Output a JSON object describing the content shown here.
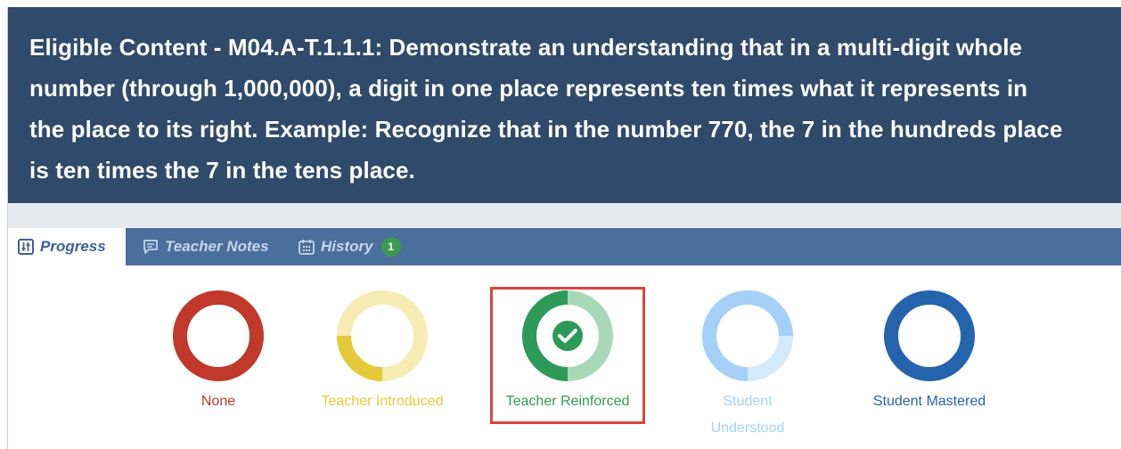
{
  "header": {
    "lines": [
      "Eligible Content - M04.A-T.1.1.1: Demonstrate an understanding that in a multi-digit whole",
      "number (through 1,000,000), a digit in one place represents ten times what it represents in",
      "the place to its right. Example: Recognize that in the number 770, the 7 in the hundreds place",
      "is ten times the 7 in the tens place."
    ]
  },
  "tabs": [
    {
      "label": "Progress",
      "icon": "sliders-icon",
      "active": true
    },
    {
      "label": "Teacher Notes",
      "icon": "comment-icon",
      "active": false
    },
    {
      "label": "History",
      "icon": "calendar-icon",
      "active": false,
      "badge": "1"
    }
  ],
  "statuses": [
    {
      "label": "None",
      "color": "#c0392b",
      "level": 0
    },
    {
      "label": "Teacher Introduced",
      "color": "#e6c93b",
      "light_color": "#f6ebb3",
      "level": 0.33
    },
    {
      "label": "Teacher Reinforced",
      "color": "#2e9a58",
      "light_color": "#a9d8b6",
      "level": 0.5,
      "selected": true,
      "icon": "check-icon"
    },
    {
      "label_line1": "Student",
      "label_line2": "Understood",
      "color": "#a4d0f8",
      "light_color": "#d3e9fc",
      "level": 0.75
    },
    {
      "label": "Student Mastered",
      "color": "#2563ad",
      "level": 1
    }
  ],
  "colors": {
    "header_bg": "#2f4a6a",
    "tabbar_bg": "#4a6f9c",
    "active_tab_text": "#3c6197",
    "selected_border": "#d9463f"
  }
}
